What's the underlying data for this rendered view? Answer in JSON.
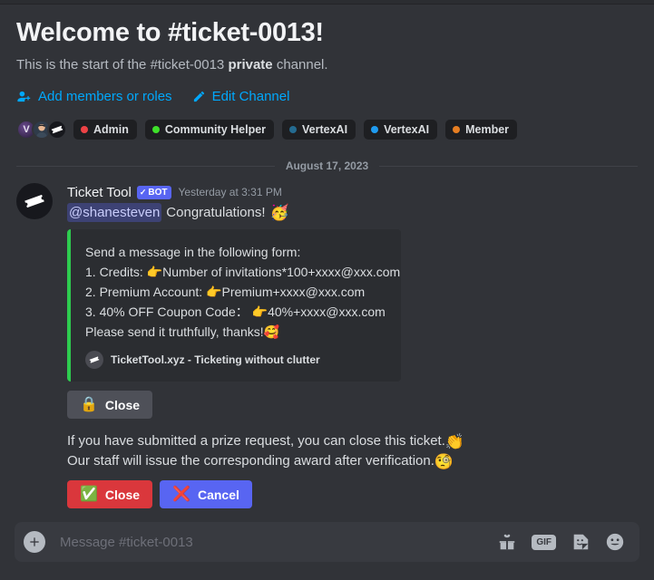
{
  "channel": {
    "name": "#ticket-0013",
    "welcome_title": "Welcome to #ticket-0013!",
    "intro_prefix": "This is the start of the ",
    "intro_channel": "#ticket-0013 ",
    "intro_bold": "private",
    "intro_suffix": " channel.",
    "add_members_label": "Add members or roles",
    "edit_channel_label": "Edit Channel"
  },
  "roles": [
    {
      "label": "Admin",
      "color": "#ed4245"
    },
    {
      "label": "Community Helper",
      "color": "#3ee02a"
    },
    {
      "label": "VertexAI",
      "color": "#246b90"
    },
    {
      "label": "VertexAI",
      "color": "#1f9bf0"
    },
    {
      "label": "Member",
      "color": "#e67e22"
    }
  ],
  "avatars": [
    {
      "name": "avatar-vertex",
      "glyph": "V"
    },
    {
      "name": "avatar-user",
      "glyph": ""
    },
    {
      "name": "avatar-ticket-tool",
      "glyph": ""
    }
  ],
  "divider": {
    "date": "August 17, 2023"
  },
  "message": {
    "author": "Ticket Tool",
    "bot_tag": "BOT",
    "bot_check": "✓",
    "timestamp": "Yesterday at 3:31 PM",
    "mention": "@shanesteven",
    "greeting": "Congratulations!",
    "greeting_emoji": "🥳"
  },
  "embed": {
    "accent_color": "#2ecc4f",
    "lines": [
      "Send a message in the following form:",
      "1. Credits: 👉Number of invitations*100+xxxx@xxx.com",
      "2. Premium Account: 👉Premium+xxxx@xxx.com",
      "3. 40% OFF Coupon Code： 👉40%+xxxx@xxx.com",
      "Please send it truthfully, thanks!🥰"
    ],
    "footer_text": "TicketTool.xyz - Ticketing without clutter"
  },
  "components": {
    "close_secondary": {
      "label": "Close",
      "emoji": "🔒"
    },
    "close_danger": {
      "label": "Close",
      "emoji": "✅"
    },
    "cancel_primary": {
      "label": "Cancel",
      "emoji": "❌"
    }
  },
  "notes": [
    {
      "text": "If you have submitted a prize request, you can close this ticket.",
      "emoji": "👏"
    },
    {
      "text": "Our staff will issue the corresponding award after verification.",
      "emoji": "🧐"
    }
  ],
  "composer": {
    "placeholder": "Message #ticket-0013",
    "gif_label": "GIF"
  }
}
